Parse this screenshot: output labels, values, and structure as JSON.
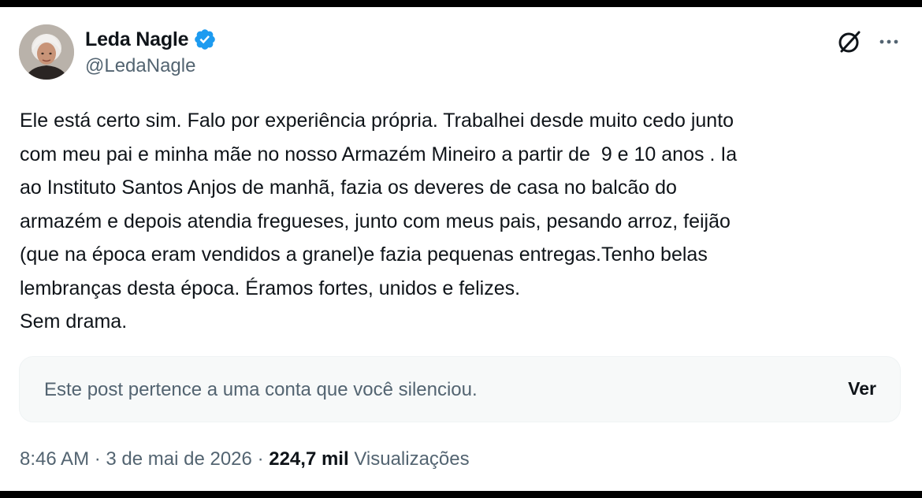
{
  "author": {
    "display_name": "Leda Nagle",
    "handle": "@LedaNagle",
    "avatar_icon": "avatar",
    "verified_icon": "verified-badge-icon",
    "verified_color": "#1d9bf0"
  },
  "header_icons": {
    "grok": "grok-icon",
    "more": "more-options-icon"
  },
  "post": {
    "lines": [
      "Ele está certo sim. Falo por experiência própria. Trabalhei desde muito cedo junto",
      "com meu pai e minha mãe no nosso Armazém Mineiro a partir de  9 e 10 anos . Ia",
      "ao Instituto Santos Anjos de manhã, fazia os deveres de casa no balcão do",
      "armazém e depois atendia fregueses, junto com meus pais, pesando arroz, feijão",
      "(que na época eram vendidos a granel)e fazia pequenas entregas.Tenho belas",
      "lembranças desta época. Éramos fortes, unidos e felizes.",
      "Sem drama."
    ]
  },
  "muted_notice": {
    "text": "Este post pertence a uma conta que você silenciou.",
    "button_label": "Ver"
  },
  "meta": {
    "time": "8:46 AM",
    "separator": "·",
    "date": "3 de mai de 2026",
    "views_count": "224,7 mil",
    "views_label": "Visualizações"
  },
  "colors": {
    "text_primary": "#0f1419",
    "text_secondary": "#536471",
    "accent": "#1d9bf0",
    "muted_box_bg": "#f7f9f9"
  }
}
